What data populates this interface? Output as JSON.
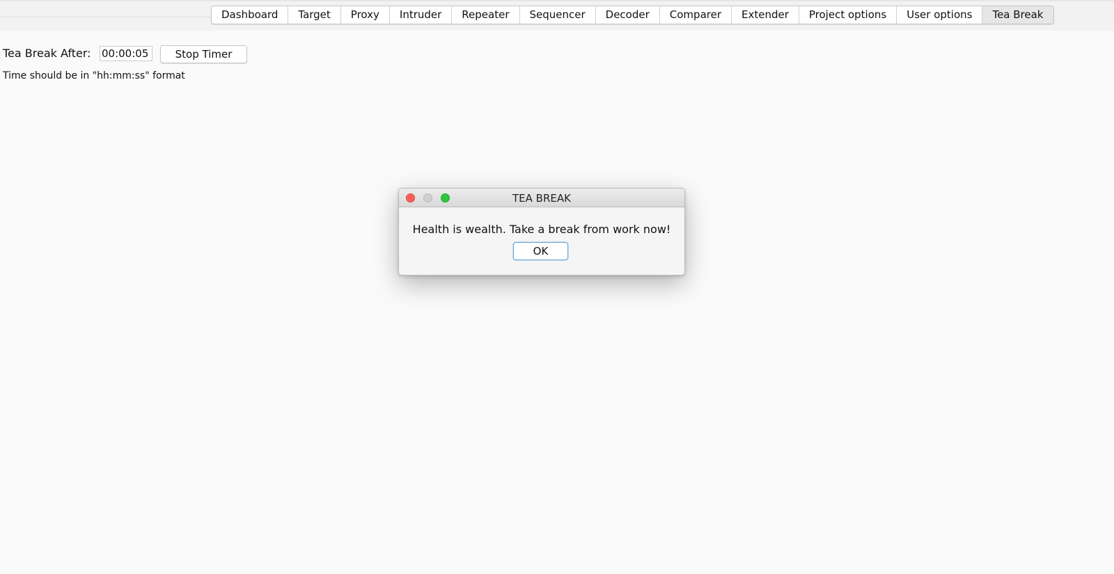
{
  "tabs": [
    {
      "label": "Dashboard",
      "active": false
    },
    {
      "label": "Target",
      "active": false
    },
    {
      "label": "Proxy",
      "active": false
    },
    {
      "label": "Intruder",
      "active": false
    },
    {
      "label": "Repeater",
      "active": false
    },
    {
      "label": "Sequencer",
      "active": false
    },
    {
      "label": "Decoder",
      "active": false
    },
    {
      "label": "Comparer",
      "active": false
    },
    {
      "label": "Extender",
      "active": false
    },
    {
      "label": "Project options",
      "active": false
    },
    {
      "label": "User options",
      "active": false
    },
    {
      "label": "Tea Break",
      "active": true
    }
  ],
  "timer": {
    "label": "Tea Break After:",
    "value": "00:00:05",
    "stop_label": "Stop Timer",
    "hint": "Time should be in \"hh:mm:ss\" format"
  },
  "dialog": {
    "title": "TEA BREAK",
    "message": "Health is wealth. Take a break from work now!",
    "ok_label": "OK"
  },
  "colors": {
    "close_light": "#fc5f57",
    "minimize_light_disabled": "#cfcfcf",
    "zoom_light": "#2bc840",
    "ok_focus_border": "#6aa7d8",
    "active_tab": "#e6e6e6"
  },
  "icons": {
    "close": "close-icon",
    "minimize": "minimize-icon",
    "zoom": "zoom-icon"
  }
}
